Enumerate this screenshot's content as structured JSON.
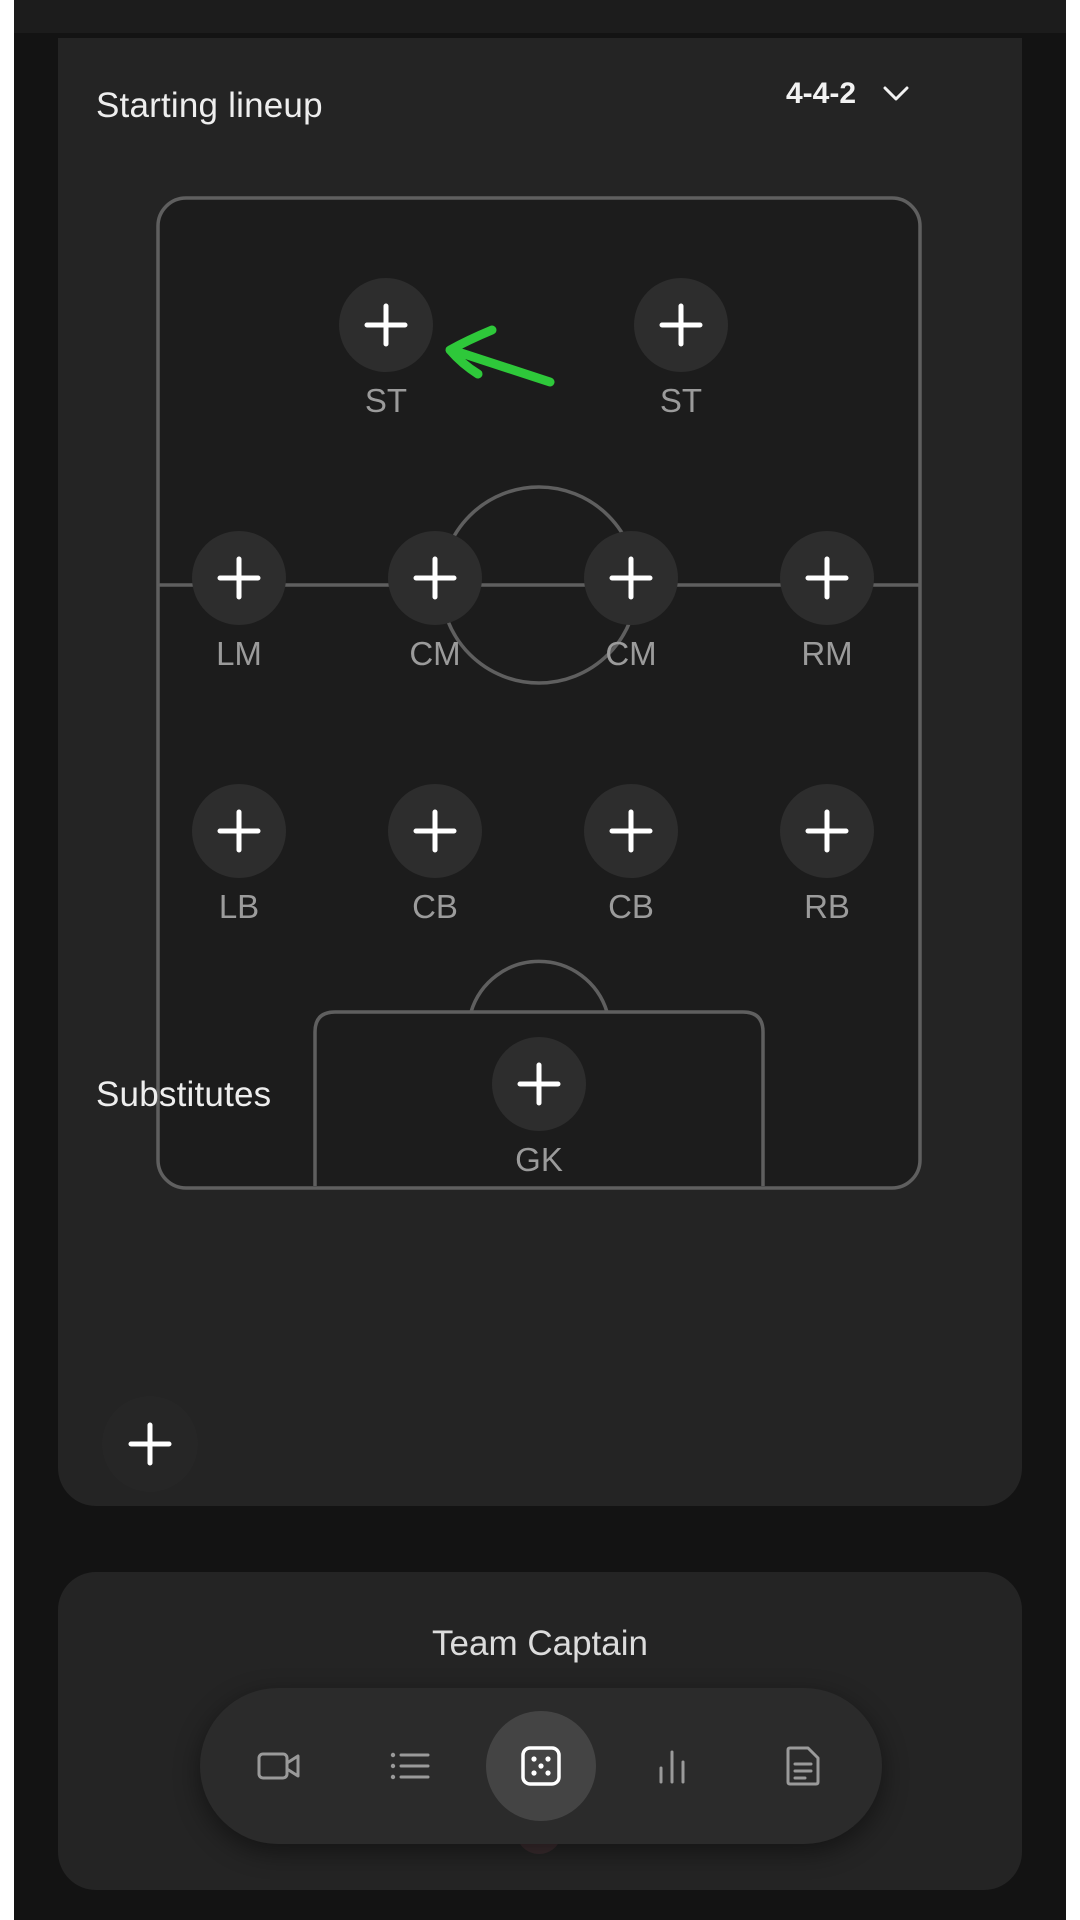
{
  "lineup": {
    "title": "Starting lineup",
    "formation": "4-4-2",
    "positions": {
      "st_left": "ST",
      "st_right": "ST",
      "lm": "LM",
      "cm_left": "CM",
      "cm_right": "CM",
      "rm": "RM",
      "lb": "LB",
      "cb_left": "CB",
      "cb_right": "CB",
      "rb": "RB",
      "gk": "GK"
    }
  },
  "substitutes": {
    "title": "Substitutes"
  },
  "captain": {
    "title": "Team Captain"
  },
  "annotation": {
    "arrow_color": "#2ec83a"
  },
  "bottom_nav": {
    "items": [
      "video-icon",
      "list-icon",
      "dice-icon",
      "bar-chart-icon",
      "document-icon"
    ],
    "active": "dice-icon"
  },
  "colors": {
    "background": "#131313",
    "card": "#242424",
    "pitch_line": "#5f5f5f",
    "slot_button": "#2d2d2d",
    "text_primary": "#eeeeee",
    "text_secondary": "#9b9b9b"
  }
}
